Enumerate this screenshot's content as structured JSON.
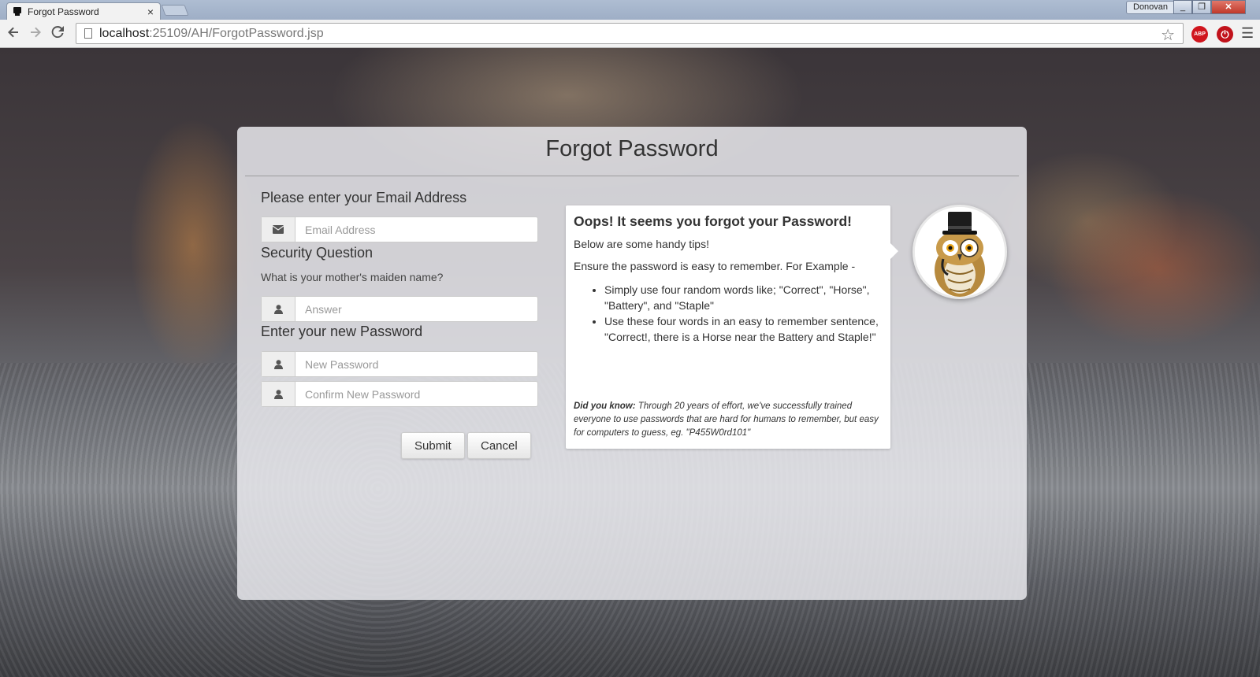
{
  "browser": {
    "tab_title": "Forgot Password",
    "tab_close": "×",
    "profile_name": "Donovan",
    "url_host": "localhost",
    "url_rest": ":25109/AH/ForgotPassword.jsp",
    "ext_abp": "ABP",
    "icons": [
      "back-arrow-icon",
      "forward-arrow-icon",
      "reload-icon",
      "page-icon",
      "star-icon",
      "adblock-icon",
      "ublock-icon",
      "menu-icon"
    ]
  },
  "form": {
    "title": "Forgot Password",
    "email_heading": "Please enter your Email Address",
    "email_placeholder": "Email Address",
    "security_heading": "Security Question",
    "security_question": "What is your mother's maiden name?",
    "answer_placeholder": "Answer",
    "password_heading": "Enter your new Password",
    "new_password_placeholder": "New Password",
    "confirm_password_placeholder": "Confirm New Password",
    "submit_label": "Submit",
    "cancel_label": "Cancel"
  },
  "tips": {
    "heading": "Oops! It seems you forgot your Password!",
    "intro": "Below are some handy tips!",
    "example_intro": "Ensure the password is easy to remember. For Example -",
    "items": [
      "Simply use four random words like; \"Correct\", \"Horse\", \"Battery\", and \"Staple\"",
      "Use these four words in an easy to remember sentence, \"Correct!, there is a Horse near the Battery and Staple!\""
    ],
    "did_you_know_label": "Did you know:",
    "did_you_know_text": " Through 20 years of effort, we've successfully trained everyone to use passwords that are hard for humans to remember, but easy for computers to guess, eg. \"P455W0rd101\""
  }
}
